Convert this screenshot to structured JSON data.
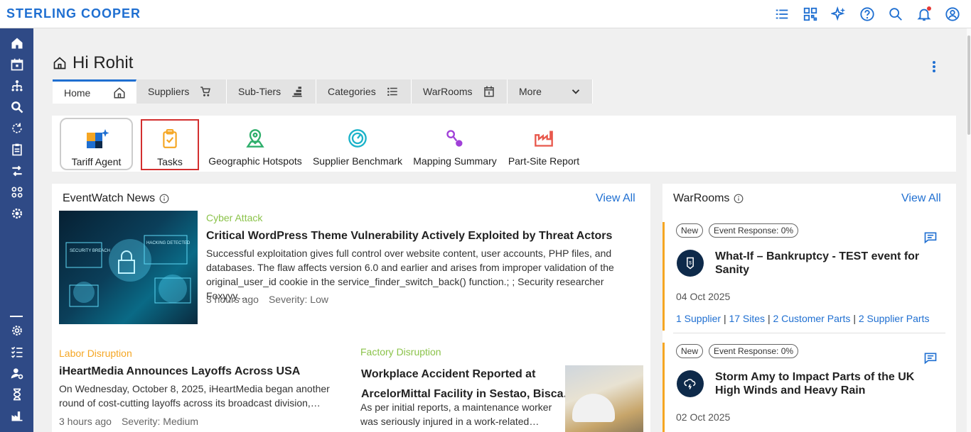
{
  "brand": "STERLING COOPER",
  "greeting": "Hi Rohit",
  "tabs": [
    {
      "label": "Home",
      "icon": "home-icon"
    },
    {
      "label": "Suppliers",
      "icon": "cart-icon"
    },
    {
      "label": "Sub-Tiers",
      "icon": "layers-icon"
    },
    {
      "label": "Categories",
      "icon": "list-icon"
    },
    {
      "label": "WarRooms",
      "icon": "calendar-icon"
    },
    {
      "label": "More",
      "icon": "chevron-down-icon"
    }
  ],
  "quick_actions": [
    {
      "label": "Tariff Agent"
    },
    {
      "label": "Tasks"
    },
    {
      "label": "Geographic Hotspots"
    },
    {
      "label": "Supplier Benchmark"
    },
    {
      "label": "Mapping Summary"
    },
    {
      "label": "Part-Site Report"
    }
  ],
  "eventwatch": {
    "title": "EventWatch News",
    "view_all": "View All",
    "featured": {
      "category": "Cyber Attack",
      "title": "Critical WordPress Theme Vulnerability Actively Exploited by Threat Actors",
      "desc_lines": [
        "Successful exploitation gives full control over website content, user accounts, PHP files, and",
        "databases. The flaw affects version 6.0 and earlier and arises from improper validation of the",
        "original_user_id cookie in the service_finder_switch_back() function.; ; Security researcher Foxyyy…"
      ],
      "time": "3 hours ago",
      "severity": "Severity: Low",
      "image_text": [
        "SECURITY BREACH",
        "HACKING DETECTED"
      ]
    },
    "item2": {
      "category": "Labor Disruption",
      "title": "iHeartMedia Announces Layoffs Across USA",
      "desc_lines": [
        "On Wednesday, October 8, 2025, iHeartMedia began another",
        "round of cost-cutting layoffs across its broadcast division,…"
      ],
      "time": "3 hours ago",
      "severity": "Severity: Medium"
    },
    "item3": {
      "category": "Factory Disruption",
      "title_line1": "Workplace Accident Reported at",
      "title_line2": "ArcelorMittal Facility in Sestao, Bisca…",
      "desc_lines": [
        "As per initial reports, a maintenance worker",
        "was seriously injured in a work-related…"
      ]
    }
  },
  "warrooms": {
    "title": "WarRooms",
    "view_all": "View All",
    "cards": [
      {
        "pill_new": "New",
        "pill_response": "Event Response: 0%",
        "title_line1": "What-If – Bankruptcy - TEST event for",
        "title_line2": "Sanity",
        "date": "04 Oct 2025",
        "links": [
          "1 Supplier",
          "17 Sites",
          "2 Customer Parts",
          "2 Supplier Parts"
        ]
      },
      {
        "pill_new": "New",
        "pill_response": "Event Response: 0%",
        "title_line1": "Storm Amy to Impact Parts of the UK",
        "title_line2": "High Winds and Heavy Rain",
        "date": "02 Oct 2025"
      }
    ]
  },
  "colors": {
    "brand_blue": "#1f6fd1",
    "sidebar": "#2f4a86",
    "warroom_accent": "#f5a623",
    "tasks_highlight": "#d32f2f"
  }
}
